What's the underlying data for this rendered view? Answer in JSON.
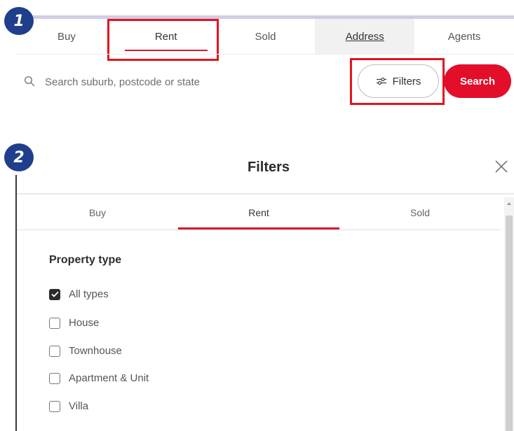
{
  "steps": {
    "one": "1",
    "two": "2"
  },
  "search_bar": {
    "tabs": [
      {
        "label": "Buy"
      },
      {
        "label": "Rent"
      },
      {
        "label": "Sold"
      },
      {
        "label": "Address"
      },
      {
        "label": "Agents"
      }
    ],
    "active_tab": "Rent",
    "search_placeholder": "Search suburb, postcode or state",
    "filters_label": "Filters",
    "search_label": "Search"
  },
  "filters_modal": {
    "title": "Filters",
    "tabs": [
      {
        "label": "Buy"
      },
      {
        "label": "Rent"
      },
      {
        "label": "Sold"
      }
    ],
    "active_tab": "Rent",
    "property_type": {
      "title": "Property type",
      "options": [
        {
          "label": "All types",
          "checked": true
        },
        {
          "label": "House",
          "checked": false
        },
        {
          "label": "Townhouse",
          "checked": false
        },
        {
          "label": "Apartment & Unit",
          "checked": false
        },
        {
          "label": "Villa",
          "checked": false
        }
      ]
    }
  },
  "colors": {
    "accent_red": "#e20e2a",
    "highlight_red": "#e2141f",
    "badge_blue": "#1f3f8c"
  }
}
